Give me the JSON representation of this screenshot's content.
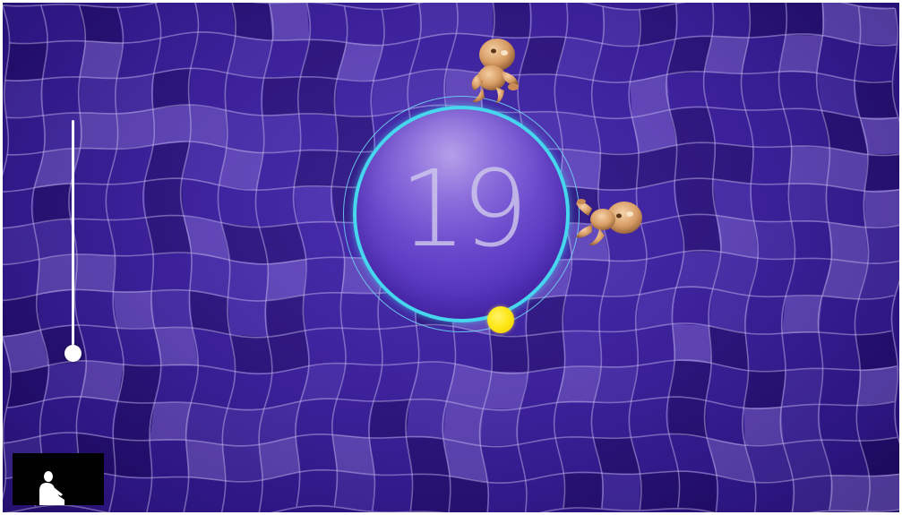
{
  "game": {
    "score": "19",
    "slider_level": 0,
    "colors": {
      "background": "#3a1f96",
      "grid_lines": "#c9c0f2",
      "dial_fill": "#6a48cc",
      "dial_ring": "#46d6ee",
      "ball": "#ffe81a",
      "slider": "#ffffff"
    },
    "icons": {
      "player_tokens": "baby-figure",
      "ball": "yellow-ball",
      "camera_preview": "player-silhouette"
    }
  }
}
